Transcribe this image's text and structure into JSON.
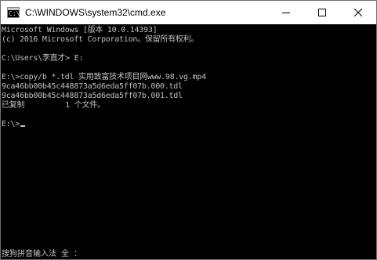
{
  "window": {
    "title": "C:\\WINDOWS\\system32\\cmd.exe",
    "icon_glyph": "C:\\",
    "controls": {
      "minimize": "minimize-icon",
      "maximize": "maximize-icon",
      "close": "close-icon"
    }
  },
  "console": {
    "lines": [
      "Microsoft Windows [版本 10.0.14393]",
      "(c) 2016 Microsoft Corporation。保留所有权利。",
      "",
      "C:\\Users\\李直才> E:",
      "",
      "E:\\>copy/b *.tdl 实用致富技术项目网www.98.vg.mp4",
      "9ca46bb00b45c448873a5d6eda5ff07b.000.tdl",
      "9ca46bb00b45c448873a5d6eda5ff07b.001.tdl",
      "已复制         1 个文件。",
      "",
      "E:\\>"
    ],
    "ime_status": "搜狗拼音输入法 全 ："
  },
  "colors": {
    "console_bg": "#000000",
    "console_fg": "#c0c0c0",
    "titlebar_bg": "#ffffff"
  }
}
